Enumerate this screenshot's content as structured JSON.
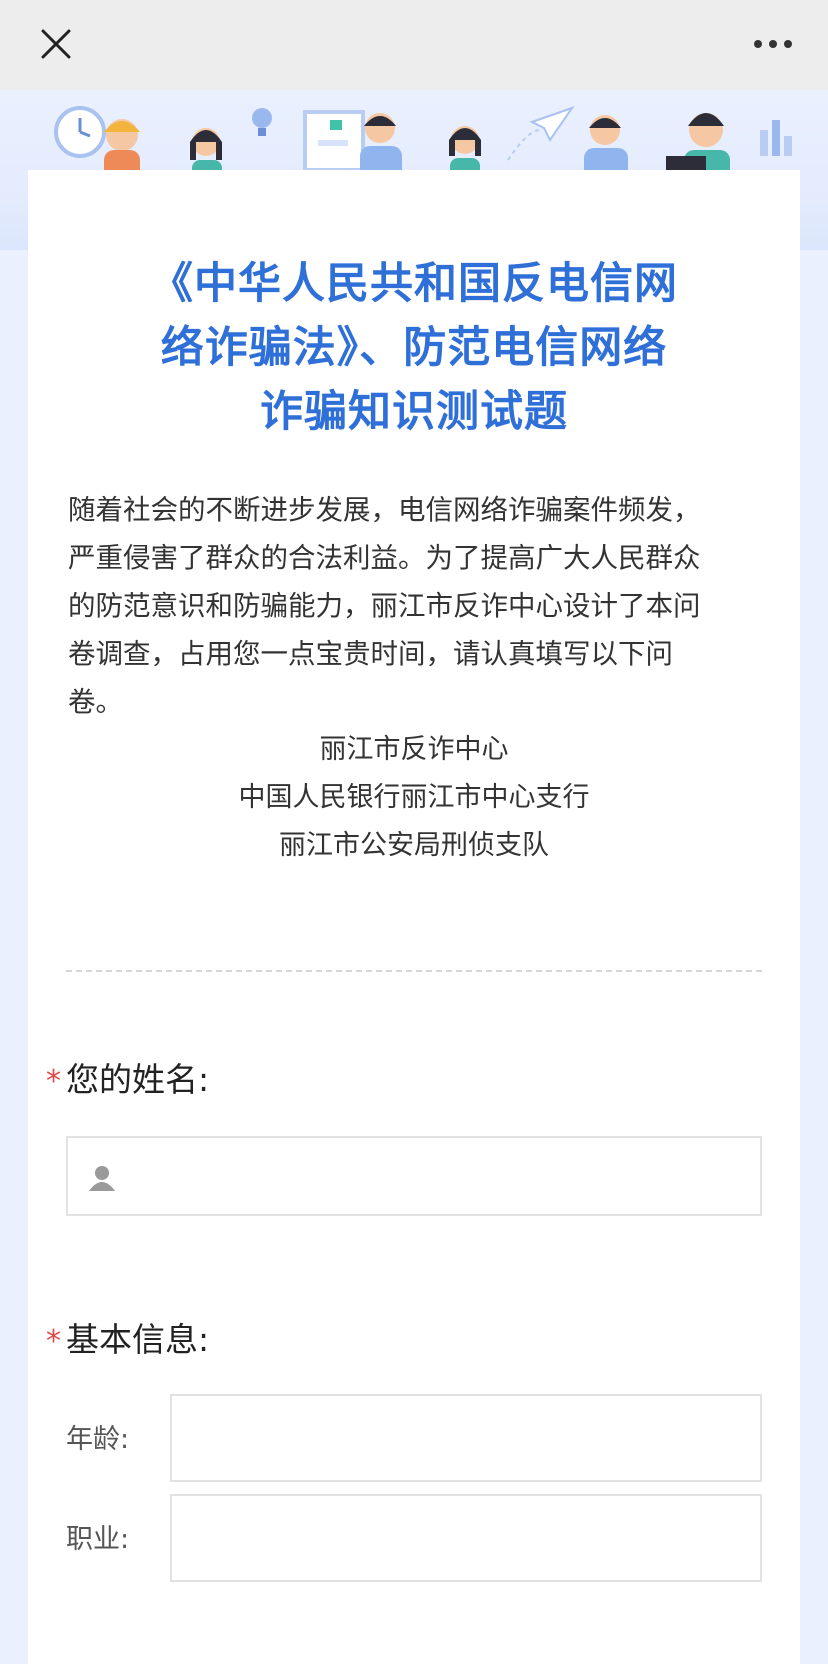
{
  "topbar": {
    "close_icon": "close-icon",
    "more_icon": "more-dots-icon"
  },
  "banner": {
    "illustration": "people-studying-illustration"
  },
  "survey": {
    "title_lines": [
      "《中华人民共和国反电信网",
      "络诈骗法》、防范电信网络",
      "诈骗知识测试题"
    ],
    "intro_lines": [
      "随着社会的不断进步发展，电信网络诈骗案件频发，",
      "严重侵害了群众的合法利益。为了提高广大人民群众",
      "的防范意识和防骗能力，丽江市反诈中心设计了本问",
      "卷调查，占用您一点宝贵时间，请认真填写以下问",
      "卷。"
    ],
    "signatures": [
      "丽江市反诈中心",
      "中国人民银行丽江市中心支行",
      "丽江市公安局刑侦支队"
    ]
  },
  "form": {
    "required_mark": "*",
    "name_question": {
      "label": "您的姓名:",
      "value": "",
      "icon": "person-icon"
    },
    "basic_info": {
      "label": "基本信息:",
      "fields": [
        {
          "label": "年龄:",
          "value": ""
        },
        {
          "label": "职业:",
          "value": ""
        }
      ]
    }
  },
  "colors": {
    "title": "#2f6fd8",
    "required": "#e04848",
    "page_bg": "#eef3fd"
  }
}
